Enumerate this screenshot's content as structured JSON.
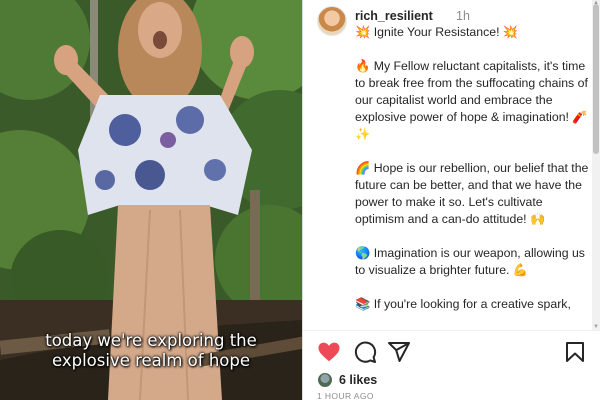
{
  "video": {
    "subtitle_line1": "today we're exploring the",
    "subtitle_line2": "explosive realm of hope"
  },
  "post": {
    "username": "rich_resilient",
    "time_ago": "1h",
    "caption": [
      "💥 Ignite Your Resistance! 💥",
      "🔥 My Fellow reluctant capitalists, it's time to break free from the suffocating chains of our capitalist world and embrace the explosive power of hope & imagination! 🧨✨",
      "🌈 Hope is our rebellion, our belief that the future can be better, and that we have the power to make it so. Let's cultivate optimism and a can-do attitude! 🙌",
      "🌎 Imagination is our weapon, allowing us to visualize a brighter future. 💪",
      "📚 If you're looking for a creative spark,"
    ],
    "likes": "6 likes",
    "timestamp": "1 HOUR AGO"
  },
  "actions": {
    "like_icon": "heart-filled-icon",
    "comment_icon": "comment-icon",
    "share_icon": "send-icon",
    "save_icon": "bookmark-icon"
  },
  "colors": {
    "like": "#ed4956",
    "text": "#262626",
    "muted": "#8e8e8e",
    "subtitle": "#ffffff"
  }
}
